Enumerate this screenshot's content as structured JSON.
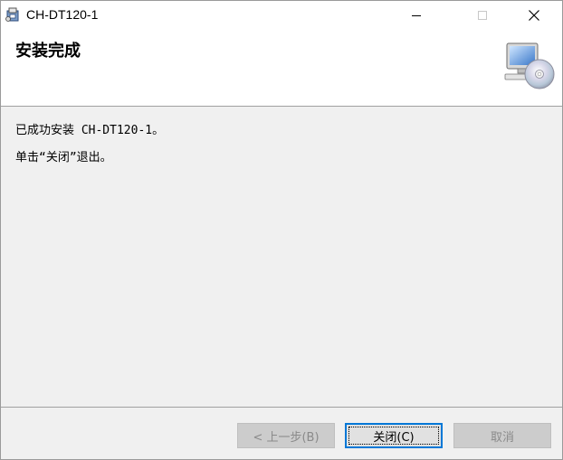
{
  "window": {
    "title": "CH-DT120-1",
    "icon": "installer-package-icon"
  },
  "window_controls": {
    "minimize_icon": "minimize-icon",
    "maximize_icon": "maximize-icon",
    "close_icon": "close-icon"
  },
  "banner": {
    "title": "安装完成",
    "graphic_icon": "computer-with-cd-icon"
  },
  "messages": [
    "已成功安装 CH-DT120-1。",
    "单击“关闭”退出。"
  ],
  "buttons": {
    "back_label": "< 上一步(B)",
    "close_label": "关闭(C)",
    "cancel_label": "取消"
  },
  "colors": {
    "focus_accent": "#0078d7",
    "dialog_background": "#f0f0f0",
    "disabled_text": "#8a8a8a"
  }
}
